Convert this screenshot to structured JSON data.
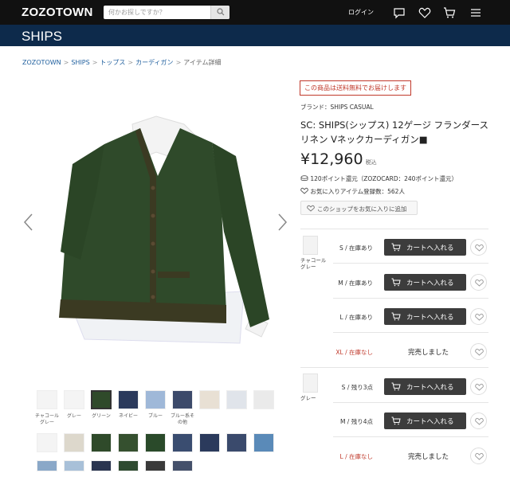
{
  "header": {
    "logo": "ZOZOTOWN",
    "search_placeholder": "何かお探しですか？",
    "login_label": "ログイン"
  },
  "brand_bar": {
    "name": "SHIPS"
  },
  "breadcrumb": [
    "ZOZOTOWN",
    "SHIPS",
    "トップス",
    "カーディガン",
    "アイテム詳細"
  ],
  "product": {
    "free_shipping": "この商品は送料無料でお届けします",
    "brand_line": "ブランド：SHIPS CASUAL",
    "title": "SC: SHIPS(シップス) 12ゲージ フランダースリネン Vネックカーディガン■",
    "price": "¥12,960",
    "tax_label": "税込",
    "points": "120ポイント還元（ZOZOCARD：240ポイント還元）",
    "favorite_count": "お気に入りアイテム登録数：562人",
    "shop_favorite_label": "このショップをお気に入りに追加"
  },
  "colors": {
    "dark_green": "#2f4a2a",
    "navy_bar": "#0d2a4b",
    "cart_button": "#3c3c3c",
    "soldout_red": "#c0392b"
  },
  "variants": [
    {
      "color_name": "チャコールグレー",
      "sizes": [
        {
          "size_label": "S / 在庫あり",
          "available": true
        },
        {
          "size_label": "M / 在庫あり",
          "available": true
        },
        {
          "size_label": "L / 在庫あり",
          "available": true
        },
        {
          "size_label": "XL / 在庫なし",
          "available": false
        }
      ]
    },
    {
      "color_name": "グレー",
      "sizes": [
        {
          "size_label": "S / 残り3点",
          "available": true
        },
        {
          "size_label": "M / 残り4点",
          "available": true
        },
        {
          "size_label": "L / 在庫なし",
          "available": false
        }
      ]
    }
  ],
  "cart_label": "カートへ入れる",
  "soldout_label": "完売しました",
  "thumb_labels": [
    "チャコールグレー",
    "グレー",
    "グリーン",
    "ネイビー",
    "ブルー",
    "ブルー系その他"
  ],
  "icons": [
    "search-icon",
    "chat-icon",
    "heart-icon",
    "cart-icon",
    "menu-icon",
    "coin-icon",
    "chevron-left-icon",
    "chevron-right-icon"
  ]
}
